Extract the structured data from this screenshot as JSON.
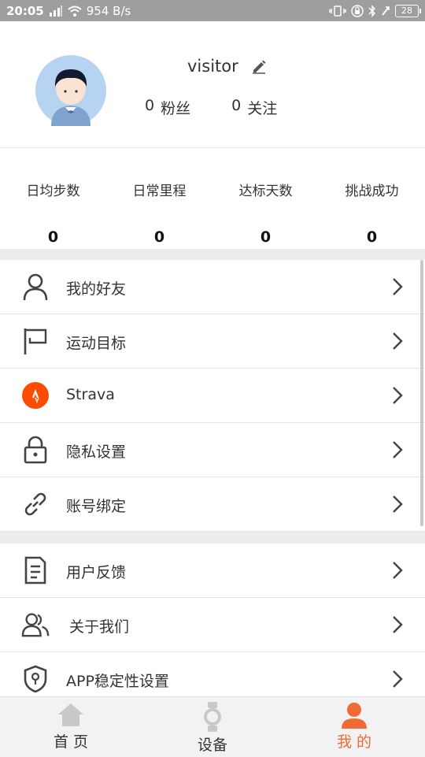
{
  "status_bar": {
    "time": "20:05",
    "network_speed": "954 B/s",
    "battery": "28"
  },
  "profile": {
    "username": "visitor",
    "fans_count": "0",
    "fans_label": "粉丝",
    "following_count": "0",
    "following_label": "关注"
  },
  "stats": [
    {
      "label": "日均步数",
      "value": "0"
    },
    {
      "label": "日常里程",
      "value": "0"
    },
    {
      "label": "达标天数",
      "value": "0"
    },
    {
      "label": "挑战成功",
      "value": "0"
    }
  ],
  "menu_group1": [
    {
      "label": "我的好友",
      "icon": "person-icon"
    },
    {
      "label": "运动目标",
      "icon": "flag-icon"
    },
    {
      "label": "Strava",
      "icon": "strava-icon"
    },
    {
      "label": "隐私设置",
      "icon": "lock-icon"
    },
    {
      "label": "账号绑定",
      "icon": "link-icon"
    }
  ],
  "menu_group2": [
    {
      "label": "用户反馈",
      "icon": "document-icon"
    },
    {
      "label": "关于我们",
      "icon": "people-icon"
    },
    {
      "label": "APP稳定性设置",
      "icon": "shield-icon"
    }
  ],
  "bottom_nav": [
    {
      "label": "首 页",
      "icon": "home-icon"
    },
    {
      "label": "设备",
      "icon": "watch-icon"
    },
    {
      "label": "我 的",
      "icon": "profile-icon",
      "active": true
    }
  ],
  "colors": {
    "accent": "#f06a35",
    "strava": "#fc4c02",
    "separator": "#ececec",
    "status_bar": "#9e9e9e"
  }
}
